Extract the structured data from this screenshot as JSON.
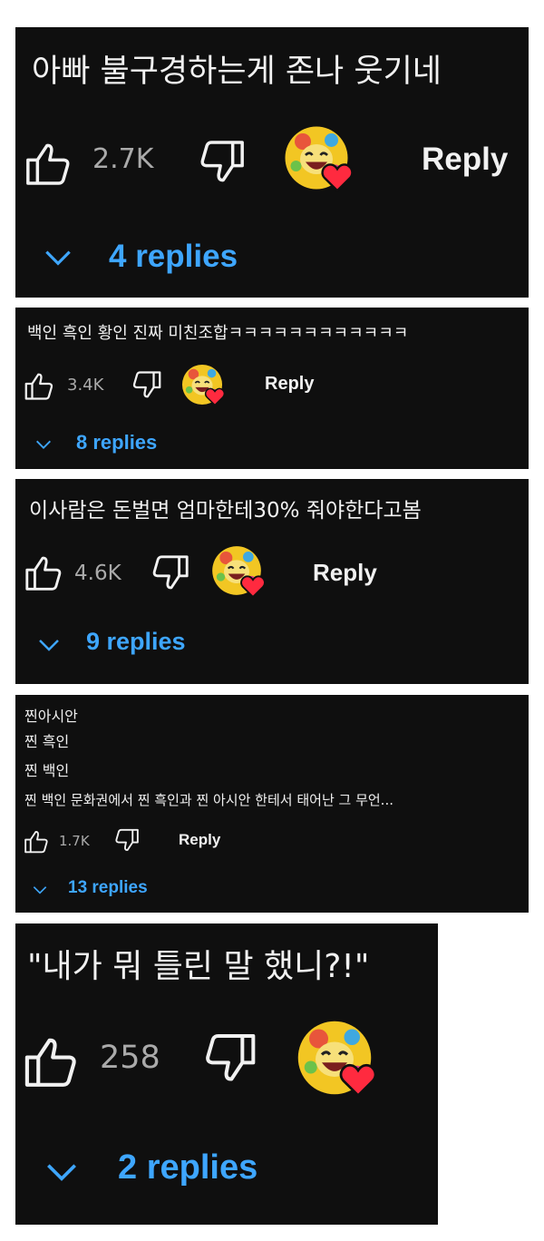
{
  "comments": [
    {
      "text": "아빠 불구경하는게 존나 웃기네",
      "likes": "2.7K",
      "reply_label": "Reply",
      "replies": "4 replies",
      "like_icon": "thumbs-up-icon",
      "dislike_icon": "thumbs-down-icon",
      "creator_heart": "creator-heart-icon",
      "reply_color": "#3ea6ff"
    },
    {
      "text": "백인 흑인 황인 진짜 미친조합ㅋㅋㅋㅋㅋㅋㅋㅋㅋㅋㅋㅋ",
      "likes": "3.4K",
      "reply_label": "Reply",
      "replies": "8 replies"
    },
    {
      "text": "이사람은 돈벌면 엄마한테30% 줘야한다고봄",
      "likes": "4.6K",
      "reply_label": "Reply",
      "replies": "9 replies"
    },
    {
      "lines": [
        "찐아시안",
        "찐 흑인",
        "찐 백인",
        "찐 백인 문화권에서 찐 흑인과 찐 아시안 한테서 태어난 그 무언..."
      ],
      "likes": "1.7K",
      "reply_label": "Reply",
      "replies": "13 replies"
    },
    {
      "text": "\"내가 뭐 틀린 말 했니?!\"",
      "likes": "258",
      "reply_label": "",
      "replies": "2 replies"
    }
  ]
}
